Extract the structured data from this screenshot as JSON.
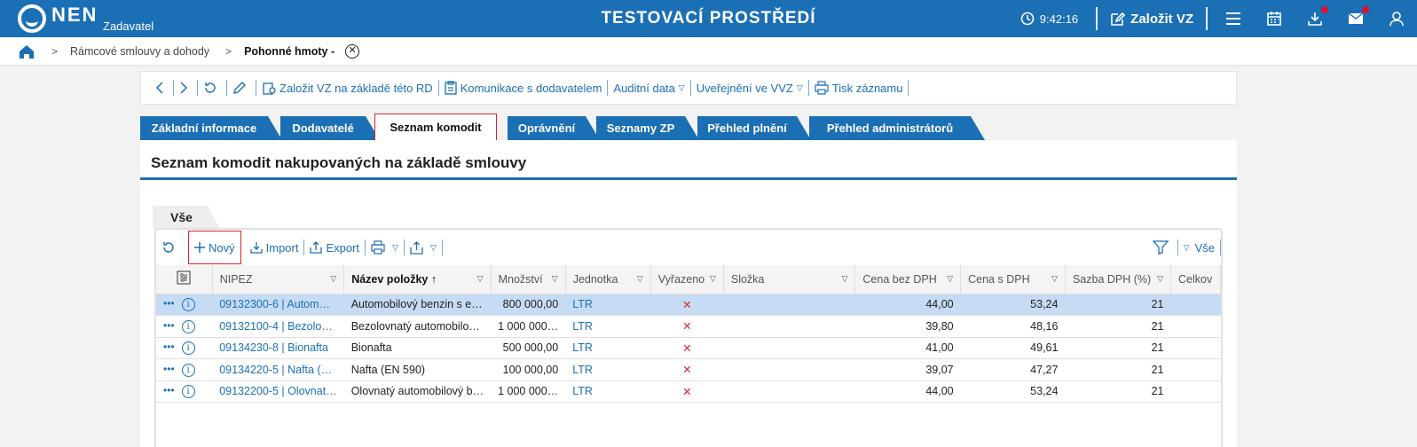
{
  "header": {
    "logo_text": "NEN",
    "logo_sub": "Zadavatel",
    "env_title": "TESTOVACÍ PROSTŘEDÍ",
    "time": "9:42:16",
    "create_label": "Založit VZ",
    "brand_color": "#1b6fb5"
  },
  "breadcrumb": {
    "items": [
      "Rámcové smlouvy a dohody",
      "Pohonné hmoty -"
    ]
  },
  "actions": {
    "create_from_rd": "Založit VZ na základě této RD",
    "communication": "Komunikace s dodavatelem",
    "audit": "Auditní data",
    "publish": "Uveřejnění ve VVZ",
    "print": "Tisk záznamu"
  },
  "tabs": [
    {
      "label": "Základní informace"
    },
    {
      "label": "Dodavatelé"
    },
    {
      "label": "Seznam komodit"
    },
    {
      "label": "Oprávnění"
    },
    {
      "label": "Seznamy ZP"
    },
    {
      "label": "Přehled plnění"
    },
    {
      "label": "Přehled administrátorů"
    }
  ],
  "panel": {
    "title": "Seznam komodit nakupovaných na základě smlouvy",
    "subtab": "Vše"
  },
  "grid_toolbar": {
    "new": "Nový",
    "import": "Import",
    "export": "Export",
    "view_all": "Vše"
  },
  "columns": {
    "nipez": "NIPEZ",
    "name": "Název položky",
    "qty": "Množství",
    "unit": "Jednotka",
    "excluded": "Vyřazeno",
    "component": "Složka",
    "price_net": "Cena bez DPH",
    "price_gross": "Cena s DPH",
    "vat": "Sazba DPH (%)",
    "total": "Celkov"
  },
  "rows": [
    {
      "nipez": "09132300-6 | Autom…",
      "name": "Automobilový benzin s e…",
      "qty": "800 000,00",
      "unit": "LTR",
      "excluded": "✕",
      "component": "",
      "price_net": "44,00",
      "price_gross": "53,24",
      "vat": "21"
    },
    {
      "nipez": "09132100-4 | Bezolo…",
      "name": "Bezolovnatý automobilo…",
      "qty": "1 000 000…",
      "unit": "LTR",
      "excluded": "✕",
      "component": "",
      "price_net": "39,80",
      "price_gross": "48,16",
      "vat": "21"
    },
    {
      "nipez": "09134230-8 | Bionafta",
      "name": "Bionafta",
      "qty": "500 000,00",
      "unit": "LTR",
      "excluded": "✕",
      "component": "",
      "price_net": "41,00",
      "price_gross": "49,61",
      "vat": "21"
    },
    {
      "nipez": "09134220-5 | Nafta (…",
      "name": "Nafta (EN 590)",
      "qty": "100 000,00",
      "unit": "LTR",
      "excluded": "✕",
      "component": "",
      "price_net": "39,07",
      "price_gross": "47,27",
      "vat": "21"
    },
    {
      "nipez": "09132200-5 | Olovnat…",
      "name": "Olovnatý automobilový b…",
      "qty": "1 000 000…",
      "unit": "LTR",
      "excluded": "✕",
      "component": "",
      "price_net": "44,00",
      "price_gross": "53,24",
      "vat": "21"
    }
  ]
}
